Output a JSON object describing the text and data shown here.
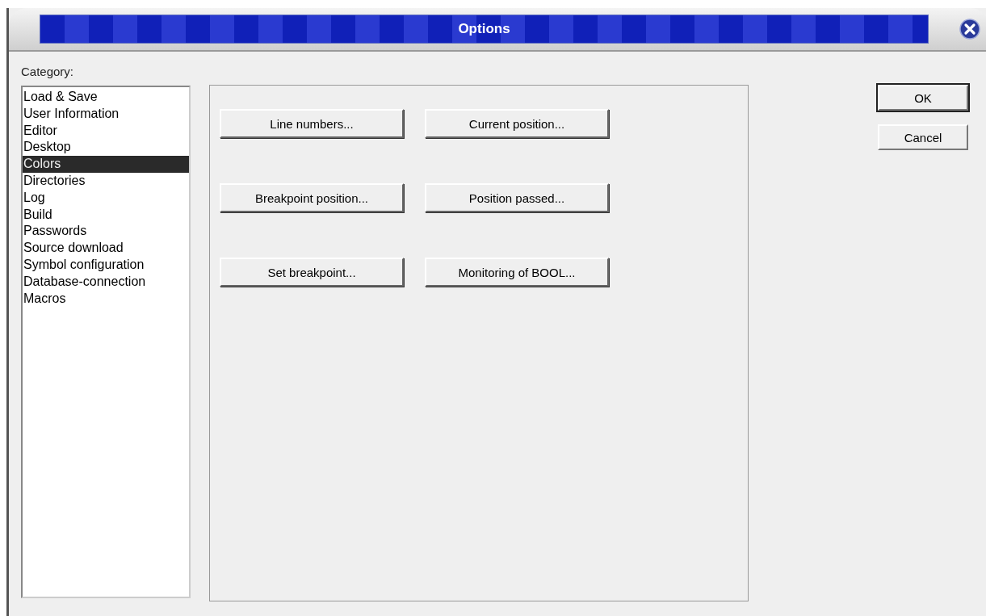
{
  "window": {
    "title": "Options"
  },
  "category": {
    "label": "Category:",
    "items": [
      {
        "label": "Load & Save",
        "selected": false
      },
      {
        "label": "User Information",
        "selected": false
      },
      {
        "label": "Editor",
        "selected": false
      },
      {
        "label": "Desktop",
        "selected": false
      },
      {
        "label": "Colors",
        "selected": true
      },
      {
        "label": "Directories",
        "selected": false
      },
      {
        "label": "Log",
        "selected": false
      },
      {
        "label": "Build",
        "selected": false
      },
      {
        "label": "Passwords",
        "selected": false
      },
      {
        "label": "Source download",
        "selected": false
      },
      {
        "label": "Symbol configuration",
        "selected": false
      },
      {
        "label": "Database-connection",
        "selected": false
      },
      {
        "label": "Macros",
        "selected": false
      }
    ]
  },
  "color_buttons": [
    "Line numbers...",
    "Current position...",
    "Breakpoint position...",
    "Position passed...",
    "Set breakpoint...",
    "Monitoring of BOOL..."
  ],
  "dialog_buttons": [
    {
      "label": "OK",
      "default": true
    },
    {
      "label": "Cancel",
      "default": false
    }
  ]
}
